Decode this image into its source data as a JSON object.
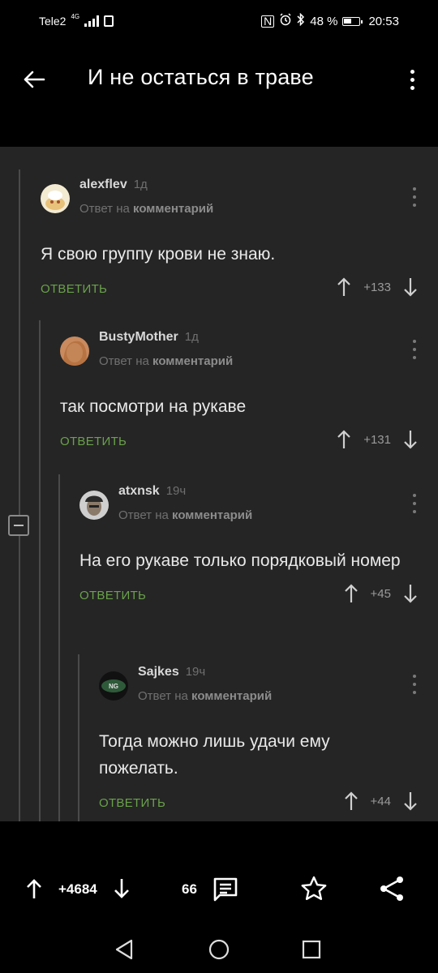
{
  "status_bar": {
    "carrier": "Tele2",
    "network": "4G",
    "battery": "48 %",
    "time": "20:53"
  },
  "header": {
    "title": "И не остаться в траве"
  },
  "comments": [
    {
      "username": "alexflev",
      "age": "1д",
      "reply_prefix": "Ответ на",
      "reply_target": "комментарий",
      "text": "Я свою группу крови не знаю.",
      "reply_label": "ОТВЕТИТЬ",
      "score": "+133"
    },
    {
      "username": "BustyMother",
      "age": "1д",
      "reply_prefix": "Ответ на",
      "reply_target": "комментарий",
      "text": "так посмотри на рукаве",
      "reply_label": "ОТВЕТИТЬ",
      "score": "+131"
    },
    {
      "username": "atxnsk",
      "age": "19ч",
      "reply_prefix": "Ответ на",
      "reply_target": "комментарий",
      "text": "На его рукаве только порядковый номер",
      "reply_label": "ОТВЕТИТЬ",
      "score": "+45"
    },
    {
      "username": "Sajkes",
      "age": "19ч",
      "reply_prefix": "Ответ на",
      "reply_target": "комментарий",
      "text": "Тогда можно лишь удачи ему пожелать.",
      "reply_label": "ОТВЕТИТЬ",
      "score": "+44"
    }
  ],
  "action_bar": {
    "post_score": "+4684",
    "comments_count": "66"
  },
  "colors": {
    "background": "#000000",
    "content": "#252525",
    "accent_green": "#6aa24a",
    "muted_text": "#707070"
  }
}
